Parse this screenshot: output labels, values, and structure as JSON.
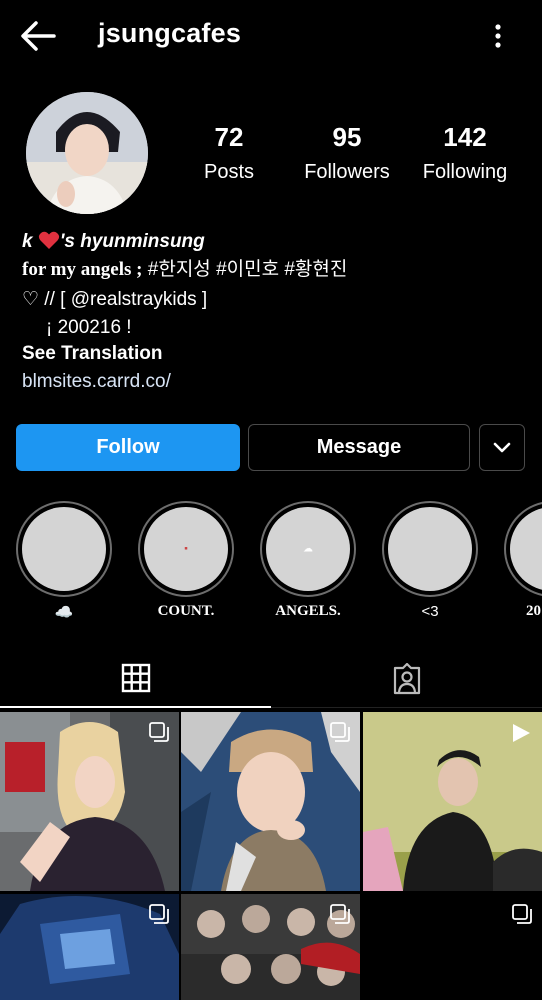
{
  "header": {
    "username": "jsungcafes"
  },
  "stats": [
    {
      "value": "72",
      "label": "Posts"
    },
    {
      "value": "95",
      "label": "Followers"
    },
    {
      "value": "142",
      "label": "Following"
    }
  ],
  "bio": {
    "name_prefix": "k",
    "name_suffix": "'s hyunminsung",
    "line1_serif": "for my angels ;",
    "line1_tags": " #한지성 #이민호 #황현진",
    "line2": "♡ // [ @realstraykids ]",
    "line3": "¡ 200216 !",
    "see_translation": "See Translation",
    "link": "blmsites.carrd.co/"
  },
  "buttons": {
    "follow": "Follow",
    "message": "Message"
  },
  "highlights": [
    {
      "caption": "☁️"
    },
    {
      "caption": "COUNT."
    },
    {
      "caption": "ANGELS."
    },
    {
      "caption": "<3"
    },
    {
      "caption": "20"
    }
  ],
  "colors": {
    "accent": "#1d96f2",
    "background": "#000000"
  },
  "icons": [
    "back-arrow-icon",
    "more-options-icon",
    "chevron-down-icon",
    "grid-icon",
    "tagged-icon",
    "multiple-posts-icon",
    "video-icon"
  ]
}
